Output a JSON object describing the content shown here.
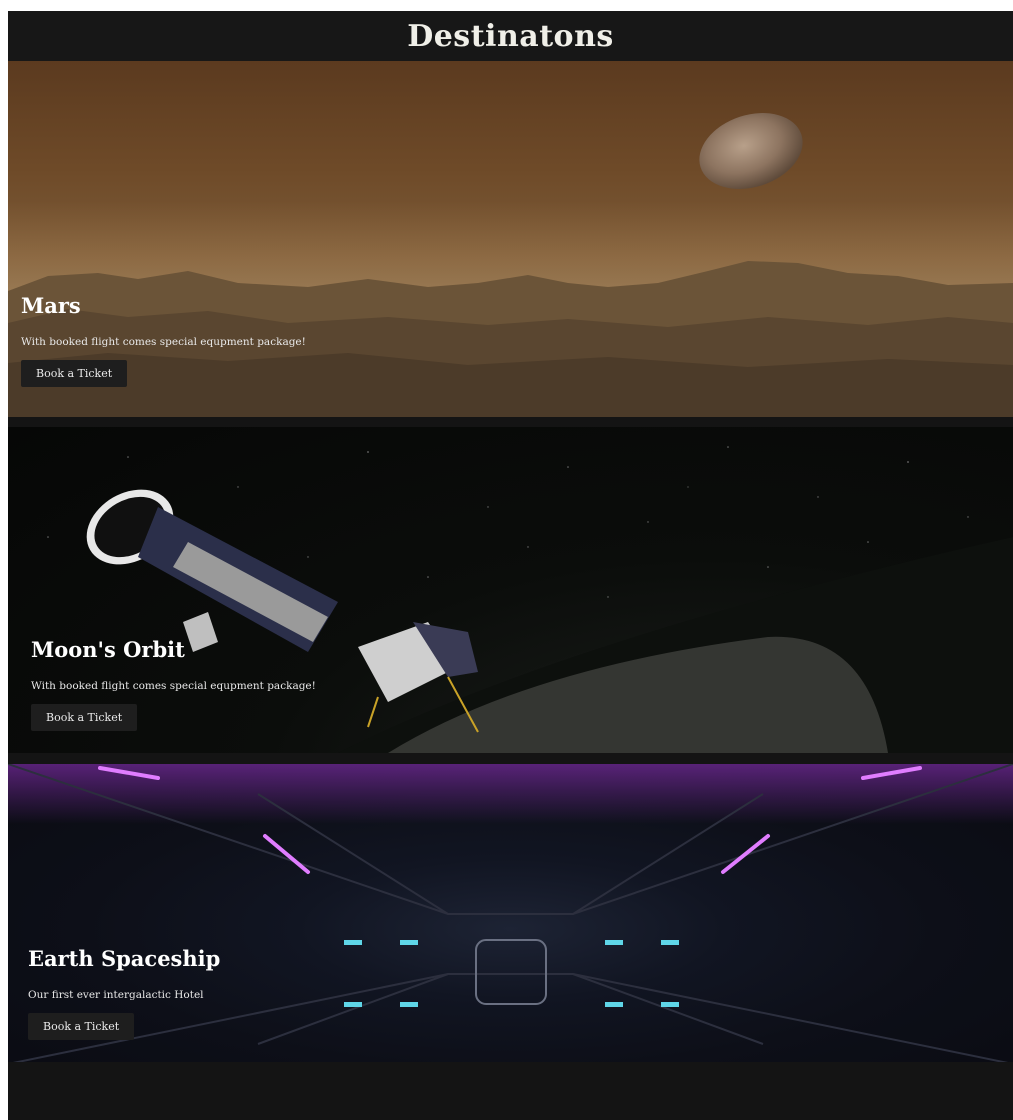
{
  "page": {
    "title": "Destinatons"
  },
  "cards": [
    {
      "title": "Mars",
      "description": "With booked flight comes special equpment package!",
      "button": "Book a Ticket"
    },
    {
      "title": "Moon's Orbit",
      "description": "With booked flight comes special equpment package!",
      "button": "Book a Ticket"
    },
    {
      "title": "Earth Spaceship",
      "description": "Our first ever intergalactic Hotel",
      "button": "Book a Ticket"
    }
  ],
  "colors": {
    "header_bg": "#171717",
    "button_bg": "#1e1e1e",
    "neon_accent": "#c13cff",
    "teal_light": "#5fd6e8"
  }
}
